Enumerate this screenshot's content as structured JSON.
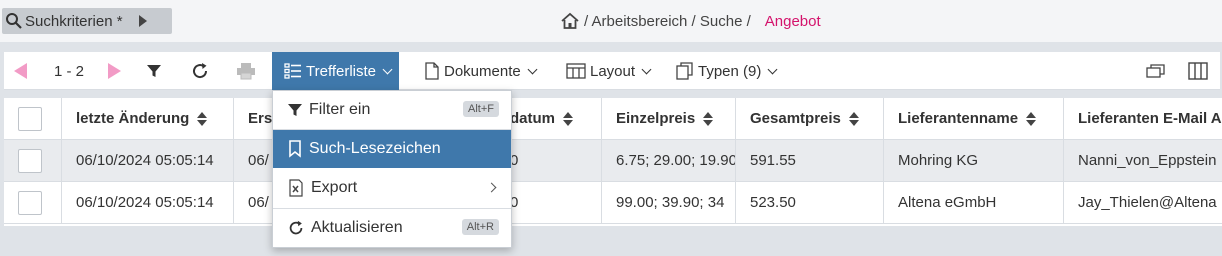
{
  "top": {
    "criteria_label": "Suchkriterien *",
    "breadcrumb": {
      "home_icon": "home-icon",
      "path": "/ Arbeitsbereich / Suche /",
      "current": "Angebot"
    }
  },
  "toolbar": {
    "range": "1 - 2",
    "trefferliste": "Trefferliste",
    "dokumente": "Dokumente",
    "layout": "Layout",
    "typen": "Typen (9)"
  },
  "table": {
    "headers": [
      "letzte Änderung",
      "Erst",
      "datum",
      "Einzelpreis",
      "Gesamtpreis",
      "Lieferantenname",
      "Lieferanten E-Mail A"
    ],
    "rows": [
      [
        "06/10/2024 05:05:14",
        "06/",
        "0",
        "6.75; 29.00; 19.90",
        "591.55",
        "Mohring KG",
        "Nanni_von_Eppstein"
      ],
      [
        "06/10/2024 05:05:14",
        "06/",
        "0",
        "99.00; 39.90; 34",
        "523.50",
        "Altena eGmbH",
        "Jay_Thielen@Altena"
      ]
    ]
  },
  "menu": {
    "filter": {
      "label": "Filter ein",
      "shortcut": "Alt+F"
    },
    "bookmark": {
      "label": "Such-Lesezeichen"
    },
    "export": {
      "label": "Export"
    },
    "refresh": {
      "label": "Aktualisieren",
      "shortcut": "Alt+R"
    }
  },
  "colors": {
    "accent": "#3f78ab",
    "brand_pink": "#d4136c",
    "nav_arrow": "#f29bc6"
  }
}
